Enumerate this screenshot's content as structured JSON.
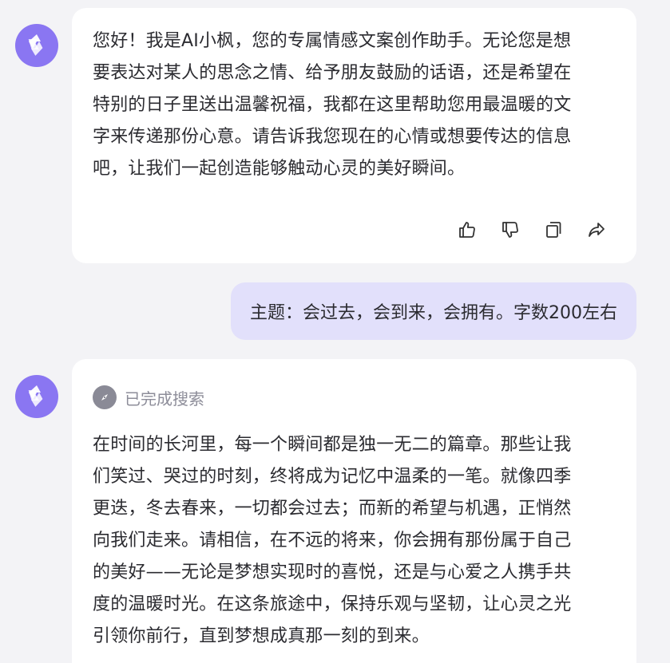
{
  "messages": [
    {
      "role": "assistant",
      "text_lines": [
        "您好！我是AI小枫，您的专属情感文案创作助手。无论您是想",
        "要表达对某人的思念之情、给予朋友鼓励的话语，还是希望在",
        "特别的日子里送出温馨祝福，我都在这里帮助您用最温暖的文",
        "字来传递那份心意。请告诉我您现在的心情或想要传达的信息",
        "吧，让我们一起创造能够触动心灵的美好瞬间。"
      ],
      "actions": [
        "thumbs-up-icon",
        "thumbs-down-icon",
        "copy-icon",
        "share-icon"
      ]
    },
    {
      "role": "user",
      "text": "主题：会过去，会到来，会拥有。字数200左右"
    },
    {
      "role": "assistant",
      "status": "已完成搜索",
      "text_lines": [
        "在时间的长河里，每一个瞬间都是独一无二的篇章。那些让我",
        "们笑过、哭过的时刻，终将成为记忆中温柔的一笔。就像四季",
        "更迭，冬去春来，一切都会过去；而新的希望与机遇，正悄然",
        "向我们走来。请相信，在不远的将来，你会拥有那份属于自己",
        "的美好——无论是梦想实现时的喜悦，还是与心爱之人携手共",
        "度的温暖时光。在这条旅途中，保持乐观与坚韧，让心灵之光",
        "引领你前行，直到梦想成真那一刻的到来。"
      ]
    }
  ],
  "colors": {
    "background": "#f3f3f6",
    "avatar": "#8a76f2",
    "user_bubble": "#e2e0fb",
    "text": "#2b2b30",
    "muted": "#8d8d99"
  }
}
